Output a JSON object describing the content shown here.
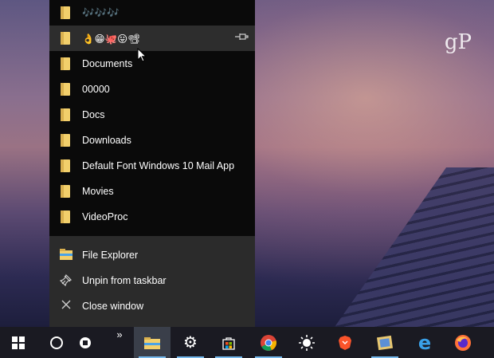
{
  "brand": {
    "logo_text": "gP"
  },
  "jumplist": {
    "recent": [
      {
        "label": "🎶🎶🎶"
      },
      {
        "label": "👌😁🐙😛📽"
      },
      {
        "label": "Documents"
      },
      {
        "label": "00000"
      },
      {
        "label": "Docs"
      },
      {
        "label": "Downloads"
      },
      {
        "label": "Default Font Windows 10 Mail App"
      },
      {
        "label": "Movies"
      },
      {
        "label": "VideoProc"
      }
    ],
    "tasks": [
      {
        "label": "File Explorer",
        "icon": "file-explorer-icon"
      },
      {
        "label": "Unpin from taskbar",
        "icon": "unpin-icon"
      },
      {
        "label": "Close window",
        "icon": "close-icon"
      }
    ]
  },
  "taskbar": {
    "icons": [
      "windows-start-icon",
      "cortana-search-icon",
      "task-view-icon",
      "overflow-chevron-icon",
      "file-explorer-icon",
      "settings-gear-icon",
      "store-icon",
      "chrome-icon",
      "weather-sun-icon",
      "brave-icon",
      "photos-app-icon",
      "edge-icon",
      "firefox-icon"
    ],
    "overflow_label": "»"
  }
}
